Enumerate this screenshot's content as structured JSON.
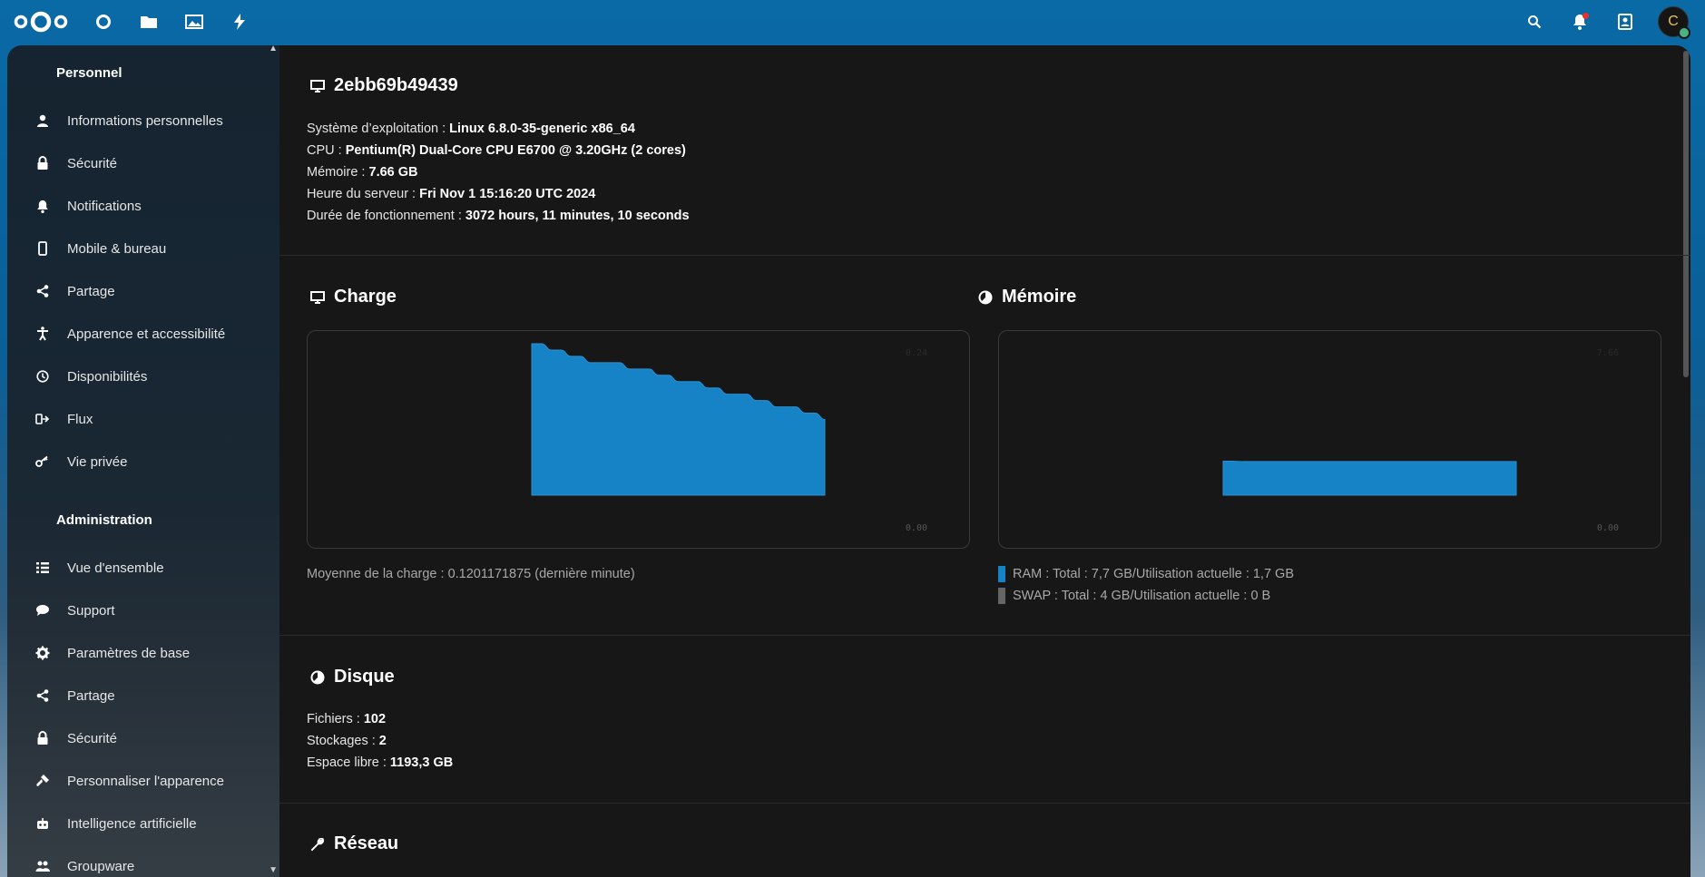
{
  "colors": {
    "accent": "#0d6fad",
    "chart_fill": "#1683c7",
    "swap_swatch": "#666666",
    "notification_dot": "#e9322d",
    "status_online": "#49b382"
  },
  "header": {
    "logo": "nextcloud-logo",
    "apps": [
      {
        "name": "dashboard-icon"
      },
      {
        "name": "files-icon"
      },
      {
        "name": "photos-icon"
      },
      {
        "name": "activity-icon"
      }
    ],
    "avatar_initial": "C"
  },
  "sidebar": {
    "personal_title": "Personnel",
    "personal_items": [
      {
        "label": "Informations personnelles",
        "icon": "user-icon"
      },
      {
        "label": "Sécurité",
        "icon": "lock-icon"
      },
      {
        "label": "Notifications",
        "icon": "bell-icon"
      },
      {
        "label": "Mobile & bureau",
        "icon": "phone-icon"
      },
      {
        "label": "Partage",
        "icon": "share-icon"
      },
      {
        "label": "Apparence et accessibilité",
        "icon": "accessibility-icon"
      },
      {
        "label": "Disponibilités",
        "icon": "clock-icon"
      },
      {
        "label": "Flux",
        "icon": "flow-icon"
      },
      {
        "label": "Vie privée",
        "icon": "key-icon"
      }
    ],
    "admin_title": "Administration",
    "admin_items": [
      {
        "label": "Vue d'ensemble",
        "icon": "list-icon"
      },
      {
        "label": "Support",
        "icon": "chat-icon"
      },
      {
        "label": "Paramètres de base",
        "icon": "gear-icon"
      },
      {
        "label": "Partage",
        "icon": "share-icon"
      },
      {
        "label": "Sécurité",
        "icon": "lock-icon"
      },
      {
        "label": "Personnaliser l'apparence",
        "icon": "paint-icon"
      },
      {
        "label": "Intelligence artificielle",
        "icon": "robot-icon"
      },
      {
        "label": "Groupware",
        "icon": "groupware-icon"
      }
    ]
  },
  "system": {
    "hostname": "2ebb69b49439",
    "os_label": "Système d’exploitation : ",
    "os_value": "Linux 6.8.0-35-generic x86_64",
    "cpu_label": "CPU : ",
    "cpu_value": "Pentium(R) Dual-Core CPU E6700 @ 3.20GHz (2 cores)",
    "mem_label": "Mémoire : ",
    "mem_value": "7.66 GB",
    "time_label": "Heure du serveur : ",
    "time_value": "Fri Nov 1 15:16:20 UTC 2024",
    "uptime_label": "Durée de fonctionnement : ",
    "uptime_value": "3072 hours, 11 minutes, 10 seconds"
  },
  "charge": {
    "title": "Charge",
    "caption": "Moyenne de la charge : 0.1201171875 (dernière minute)",
    "y_max_label": "0.24",
    "y_min_label": "0.00"
  },
  "memoire": {
    "title": "Mémoire",
    "y_max_label": "7.66",
    "y_min_label": "0.00",
    "ram_legend": "RAM : Total : 7,7 GB/Utilisation actuelle : 1,7 GB",
    "swap_legend": "SWAP : Total : 4 GB/Utilisation actuelle : 0 B"
  },
  "chart_data": [
    {
      "type": "area",
      "title": "Charge",
      "ylim": [
        0,
        0.24
      ],
      "values": [
        0.24,
        0.24,
        0.23,
        0.23,
        0.22,
        0.22,
        0.21,
        0.21,
        0.21,
        0.21,
        0.2,
        0.2,
        0.2,
        0.19,
        0.19,
        0.18,
        0.18,
        0.18,
        0.17,
        0.17,
        0.16,
        0.16,
        0.16,
        0.15,
        0.15,
        0.14,
        0.14,
        0.14,
        0.13,
        0.13,
        0.12
      ]
    },
    {
      "type": "area",
      "title": "Mémoire",
      "ylim": [
        0,
        7.66
      ],
      "series": [
        {
          "name": "RAM",
          "values": [
            1.72,
            1.72,
            1.7,
            1.7,
            1.7,
            1.7,
            1.7,
            1.7,
            1.7,
            1.7,
            1.7,
            1.7,
            1.7,
            1.7,
            1.7,
            1.7,
            1.7,
            1.7,
            1.7,
            1.7,
            1.7,
            1.7,
            1.7,
            1.7,
            1.7,
            1.7,
            1.7,
            1.7,
            1.7,
            1.7,
            1.7
          ]
        },
        {
          "name": "SWAP",
          "values": [
            0,
            0,
            0,
            0,
            0,
            0,
            0,
            0,
            0,
            0,
            0,
            0,
            0,
            0,
            0,
            0,
            0,
            0,
            0,
            0,
            0,
            0,
            0,
            0,
            0,
            0,
            0,
            0,
            0,
            0,
            0
          ]
        }
      ]
    }
  ],
  "disque": {
    "title": "Disque",
    "files_label": "Fichiers : ",
    "files_value": "102",
    "storages_label": "Stockages : ",
    "storages_value": "2",
    "free_label": "Espace libre : ",
    "free_value": "1193,3 GB"
  },
  "reseau": {
    "title": "Réseau"
  }
}
